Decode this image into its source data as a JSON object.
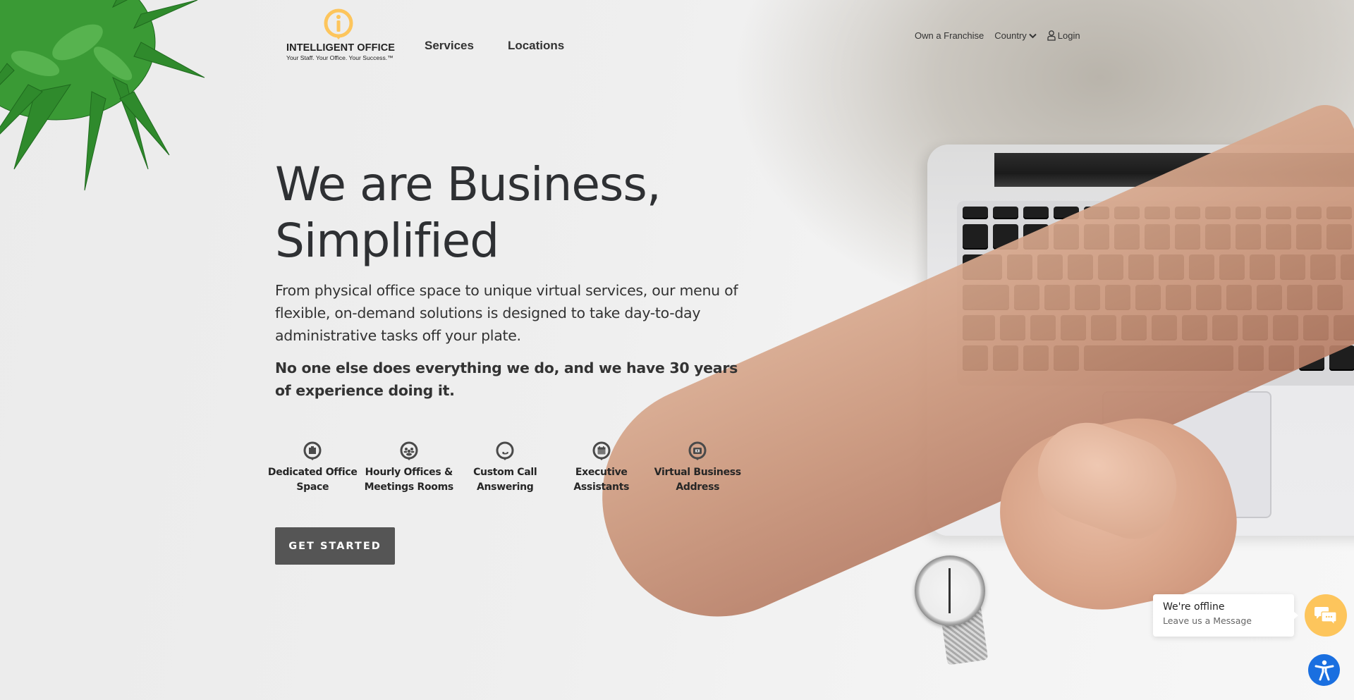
{
  "brand": {
    "name": "INTELLIGENT OFFICE",
    "tagline": "Your Staff. Your Office. Your Success.™",
    "accent": "#fdc55c"
  },
  "header": {
    "main_nav": [
      {
        "label": "Services"
      },
      {
        "label": "Locations"
      }
    ],
    "util_nav": {
      "franchise": "Own a Franchise",
      "country": "Country",
      "login": "Login"
    }
  },
  "hero": {
    "title_line1": "We are Business,",
    "title_line2": "Simplified",
    "lead": "From physical office space to unique virtual services, our menu of flexible, on-demand solutions is designed to take day-to-day administrative tasks off your plate.",
    "emphasis": "No one else does everything we do, and we have 30 years of experience doing it.",
    "cta_label": "GET STARTED",
    "cta_color": "#555555"
  },
  "services": [
    {
      "label_line1": "Dedicated Office",
      "label_line2": "Space",
      "icon": "building-icon"
    },
    {
      "label_line1": "Hourly Offices &",
      "label_line2": "Meetings Rooms",
      "icon": "people-icon"
    },
    {
      "label_line1": "Custom Call",
      "label_line2": "Answering",
      "icon": "phone-icon"
    },
    {
      "label_line1": "Executive",
      "label_line2": "Assistants",
      "icon": "calendar-icon"
    },
    {
      "label_line1": "Virtual Business",
      "label_line2": "Address",
      "icon": "mail-icon"
    }
  ],
  "chat": {
    "status": "We're offline",
    "prompt": "Leave us a Message",
    "button_color": "#fdc55c"
  },
  "accessibility": {
    "button_color": "#1a6fe0"
  }
}
